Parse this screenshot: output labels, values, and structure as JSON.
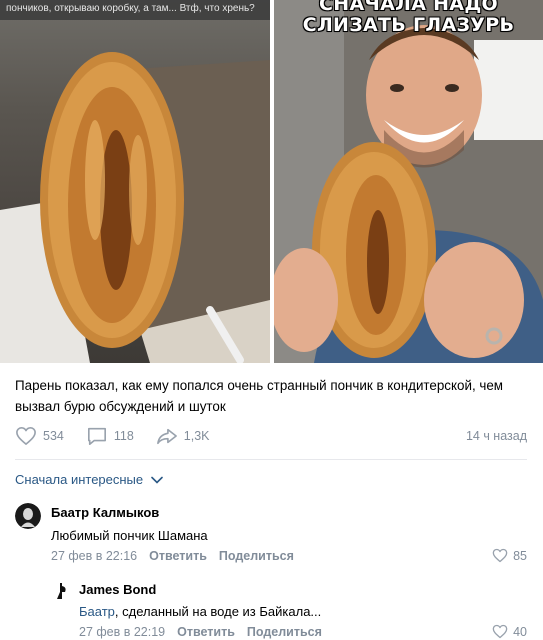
{
  "photos": {
    "left_caption": "пончиков, открываю коробку, а там... Втф, что хрень?",
    "right_overlay": "СНАЧАЛА НАДО СЛИЗАТЬ ГЛАЗУРЬ"
  },
  "post": {
    "text": "Парень показал, как ему попался очень странный пончик в кондитерской, чем вызвал бурю обсуждений и шуток",
    "likes": "534",
    "comments": "118",
    "shares": "1,3K",
    "time": "14 ч назад"
  },
  "comments_sort": {
    "label": "Сначала интересные"
  },
  "comments": [
    {
      "author": "Баатр Калмыков",
      "text": "Любимый пончик Шамана",
      "date": "27 фев в 22:16",
      "reply_label": "Ответить",
      "share_label": "Поделиться",
      "likes": "85"
    },
    {
      "author": "James Bond",
      "mention": "Баатр",
      "text": ", сделанный на воде из Байкала...",
      "date": "27 фев в 22:19",
      "reply_label": "Ответить",
      "share_label": "Поделиться",
      "likes": "40"
    }
  ],
  "colors": {
    "link": "#2a5885",
    "meta": "#818c99",
    "divider": "#e7e8ec"
  },
  "icons": [
    "heart-icon",
    "comment-icon",
    "share-icon",
    "chevron-down-icon"
  ]
}
